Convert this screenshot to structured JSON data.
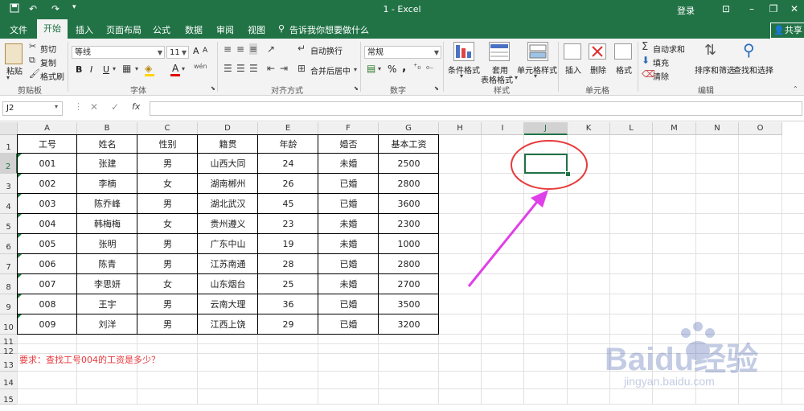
{
  "window": {
    "title": "1  -  Excel",
    "login": "登录",
    "share": "共享",
    "tell_me": "告诉我你想要做什么",
    "tabs": [
      "文件",
      "开始",
      "插入",
      "页面布局",
      "公式",
      "数据",
      "审阅",
      "视图"
    ]
  },
  "ribbon": {
    "clipboard": {
      "paste": "粘贴",
      "cut": "剪切",
      "copy": "复制",
      "format_painter": "格式刷",
      "label": "剪贴板"
    },
    "font": {
      "name": "等线",
      "size": "11",
      "label": "字体",
      "bold": "B",
      "italic": "I",
      "underline": "U",
      "grow": "A",
      "shrink": "A",
      "font_color": "A",
      "wen": "wén"
    },
    "alignment": {
      "wrap": "自动换行",
      "merge": "合并后居中",
      "label": "对齐方式"
    },
    "number": {
      "format": "常规",
      "percent": "%",
      "comma": ",",
      "label": "数字"
    },
    "styles": {
      "conditional": "条件格式",
      "table_line1": "套用",
      "table_line2": "表格格式",
      "cell_styles": "单元格样式",
      "label": "样式"
    },
    "cells": {
      "insert": "插入",
      "delete": "删除",
      "format": "格式",
      "label": "单元格"
    },
    "editing": {
      "autosum": "自动求和",
      "fill": "填充",
      "clear": "清除",
      "sort": "排序和筛选",
      "find": "查找和选择",
      "label": "编辑"
    }
  },
  "formula_bar": {
    "namebox": "J2",
    "fx": "fx",
    "value": ""
  },
  "sheet": {
    "columns": [
      "A",
      "B",
      "C",
      "D",
      "E",
      "F",
      "G",
      "H",
      "I",
      "J",
      "K",
      "L",
      "M",
      "N",
      "O"
    ],
    "rows": [
      "1",
      "2",
      "3",
      "4",
      "5",
      "6",
      "7",
      "8",
      "9",
      "10",
      "11",
      "12",
      "13",
      "14",
      "15"
    ],
    "selected_cell": "J2",
    "header_row": [
      "工号",
      "姓名",
      "性别",
      "籍贯",
      "年龄",
      "婚否",
      "基本工资"
    ],
    "data_rows": [
      [
        "001",
        "张建",
        "男",
        "山西大同",
        "24",
        "未婚",
        "2500"
      ],
      [
        "002",
        "李楠",
        "女",
        "湖南郴州",
        "26",
        "已婚",
        "2800"
      ],
      [
        "003",
        "陈乔峰",
        "男",
        "湖北武汉",
        "45",
        "已婚",
        "3600"
      ],
      [
        "004",
        "韩梅梅",
        "女",
        "贵州遵义",
        "23",
        "未婚",
        "2300"
      ],
      [
        "005",
        "张明",
        "男",
        "广东中山",
        "19",
        "未婚",
        "1000"
      ],
      [
        "006",
        "陈青",
        "男",
        "江苏南通",
        "28",
        "已婚",
        "2800"
      ],
      [
        "007",
        "李思妍",
        "女",
        "山东烟台",
        "25",
        "未婚",
        "2700"
      ],
      [
        "008",
        "王宇",
        "男",
        "云南大理",
        "36",
        "已婚",
        "3500"
      ],
      [
        "009",
        "刘洋",
        "男",
        "江西上饶",
        "29",
        "已婚",
        "3200"
      ]
    ],
    "requirement": "要求：查找工号004的工资是多少？"
  },
  "colors": {
    "excel_green": "#217346",
    "requirement_red": "#e8383d",
    "annotation_red": "#e83a3a",
    "arrow_magenta": "#e040e8"
  },
  "watermark": {
    "brand": "Baidu经验",
    "url": "jingyan.baidu.com"
  }
}
